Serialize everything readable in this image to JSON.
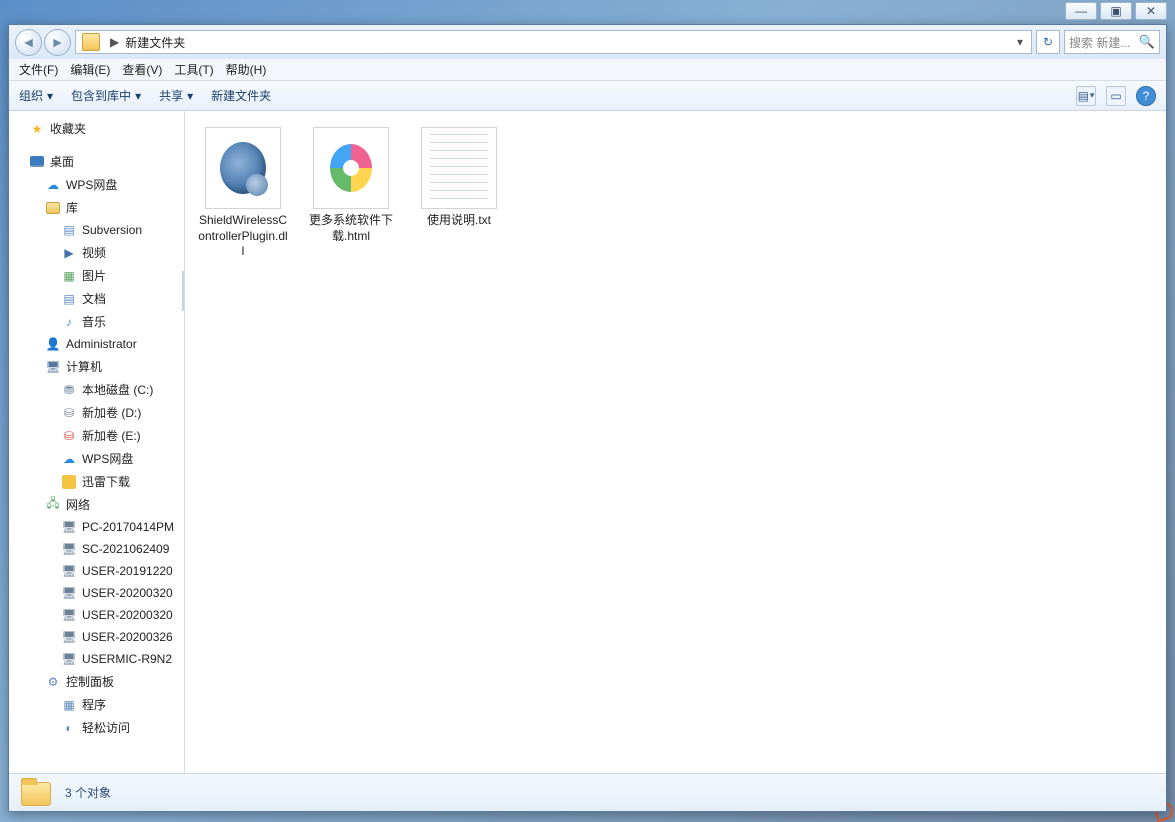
{
  "titlebar": {
    "min": "—",
    "max": "▣",
    "close": "✕"
  },
  "address": {
    "path_label": "新建文件夹",
    "sep_glyph": "▶",
    "dropdown_glyph": "▾",
    "refresh_glyph": "↻",
    "search_placeholder": "搜索 新建...",
    "search_icon": "🔍"
  },
  "menu": {
    "file": "文件(F)",
    "edit": "编辑(E)",
    "view": "查看(V)",
    "tools": "工具(T)",
    "help": "帮助(H)"
  },
  "cmd": {
    "organize": "组织",
    "include": "包含到库中",
    "share": "共享",
    "newfolder": "新建文件夹",
    "caret": "▾",
    "view_icon": "▤",
    "preview_icon": "▭",
    "help_icon": "?"
  },
  "tree": {
    "favorites": "收藏夹",
    "desktop": "桌面",
    "wps": "WPS网盘",
    "library": "库",
    "subversion": "Subversion",
    "video": "视频",
    "pictures": "图片",
    "documents": "文档",
    "music": "音乐",
    "admin": "Administrator",
    "computer": "计算机",
    "cdrive": "本地磁盘 (C:)",
    "ddrive": "新加卷 (D:)",
    "edrive": "新加卷 (E:)",
    "wps2": "WPS网盘",
    "thunder": "迅雷下载",
    "network": "网络",
    "net_items": [
      "PC-20170414PM",
      "SC-2021062409",
      "USER-20191220",
      "USER-20200320",
      "USER-20200320",
      "USER-20200326",
      "USERMIC-R9N2"
    ],
    "control_panel": "控制面板",
    "programs": "程序",
    "ease": "轻松访问"
  },
  "files": [
    {
      "name": "ShieldWirelessControllerPlugin.dll",
      "kind": "dll"
    },
    {
      "name": "更多系统软件下载.html",
      "kind": "html"
    },
    {
      "name": "使用说明.txt",
      "kind": "txt"
    }
  ],
  "status": {
    "text": "3 个对象"
  }
}
